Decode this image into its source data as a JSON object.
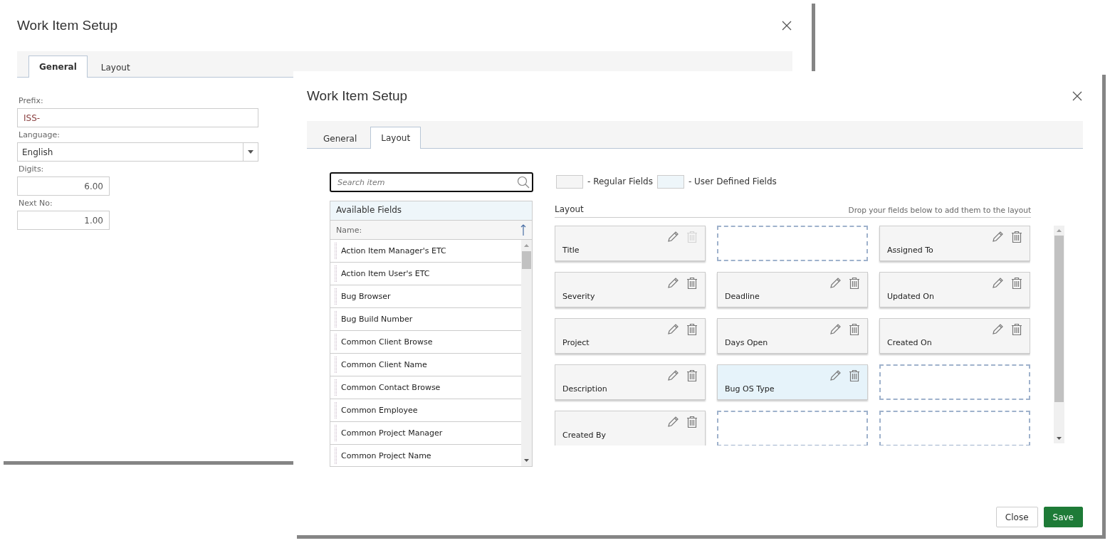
{
  "background_dialog": {
    "title": "Work Item Setup",
    "tabs": [
      {
        "label": "General",
        "selected": true
      },
      {
        "label": "Layout",
        "selected": false
      }
    ],
    "form": [
      {
        "kind": "text",
        "label": "Prefix:",
        "value": "ISS-"
      },
      {
        "kind": "select",
        "label": "Language:",
        "value": "English"
      },
      {
        "kind": "number",
        "label": "Digits:",
        "value": "6.00"
      },
      {
        "kind": "number",
        "label": "Next No:",
        "value": "1.00"
      }
    ]
  },
  "dialog": {
    "title": "Work Item Setup",
    "tabs": [
      {
        "label": "General",
        "selected": false
      },
      {
        "label": "Layout",
        "selected": true
      }
    ],
    "search": {
      "placeholder": "Search item"
    },
    "available_fields": {
      "title": "Available Fields",
      "column": "Name:",
      "items": [
        "Action Item Manager's ETC",
        "Action Item User's ETC",
        "Bug Browser",
        "Bug Build Number",
        "Common Client Browse",
        "Common Client Name",
        "Common Contact Browse",
        "Common Employee",
        "Common Project Manager",
        "Common Project Name"
      ]
    },
    "legend": [
      {
        "kind": "regular",
        "label": "- Regular Fields"
      },
      {
        "kind": "user_defined",
        "label": "- User Defined Fields"
      }
    ],
    "layout": {
      "title": "Layout",
      "hint": "Drop your fields below to add them to the layout",
      "cells": [
        {
          "kind": "field",
          "label": "Title",
          "user_defined": false,
          "delete_disabled": true
        },
        {
          "kind": "empty"
        },
        {
          "kind": "field",
          "label": "Assigned To",
          "user_defined": false,
          "delete_disabled": false
        },
        {
          "kind": "field",
          "label": "Severity",
          "user_defined": false,
          "delete_disabled": false
        },
        {
          "kind": "field",
          "label": "Deadline",
          "user_defined": false,
          "delete_disabled": false
        },
        {
          "kind": "field",
          "label": "Updated On",
          "user_defined": false,
          "delete_disabled": false
        },
        {
          "kind": "field",
          "label": "Project",
          "user_defined": false,
          "delete_disabled": false
        },
        {
          "kind": "field",
          "label": "Days Open",
          "user_defined": false,
          "delete_disabled": false
        },
        {
          "kind": "field",
          "label": "Created On",
          "user_defined": false,
          "delete_disabled": false
        },
        {
          "kind": "field",
          "label": "Description",
          "user_defined": false,
          "delete_disabled": false
        },
        {
          "kind": "field",
          "label": "Bug OS Type",
          "user_defined": true,
          "delete_disabled": false
        },
        {
          "kind": "empty"
        },
        {
          "kind": "field",
          "label": "Created By",
          "user_defined": false,
          "delete_disabled": false
        },
        {
          "kind": "empty"
        },
        {
          "kind": "empty"
        }
      ]
    },
    "buttons": [
      {
        "kind": "secondary",
        "label": "Close"
      },
      {
        "kind": "primary",
        "label": "Save"
      }
    ]
  }
}
